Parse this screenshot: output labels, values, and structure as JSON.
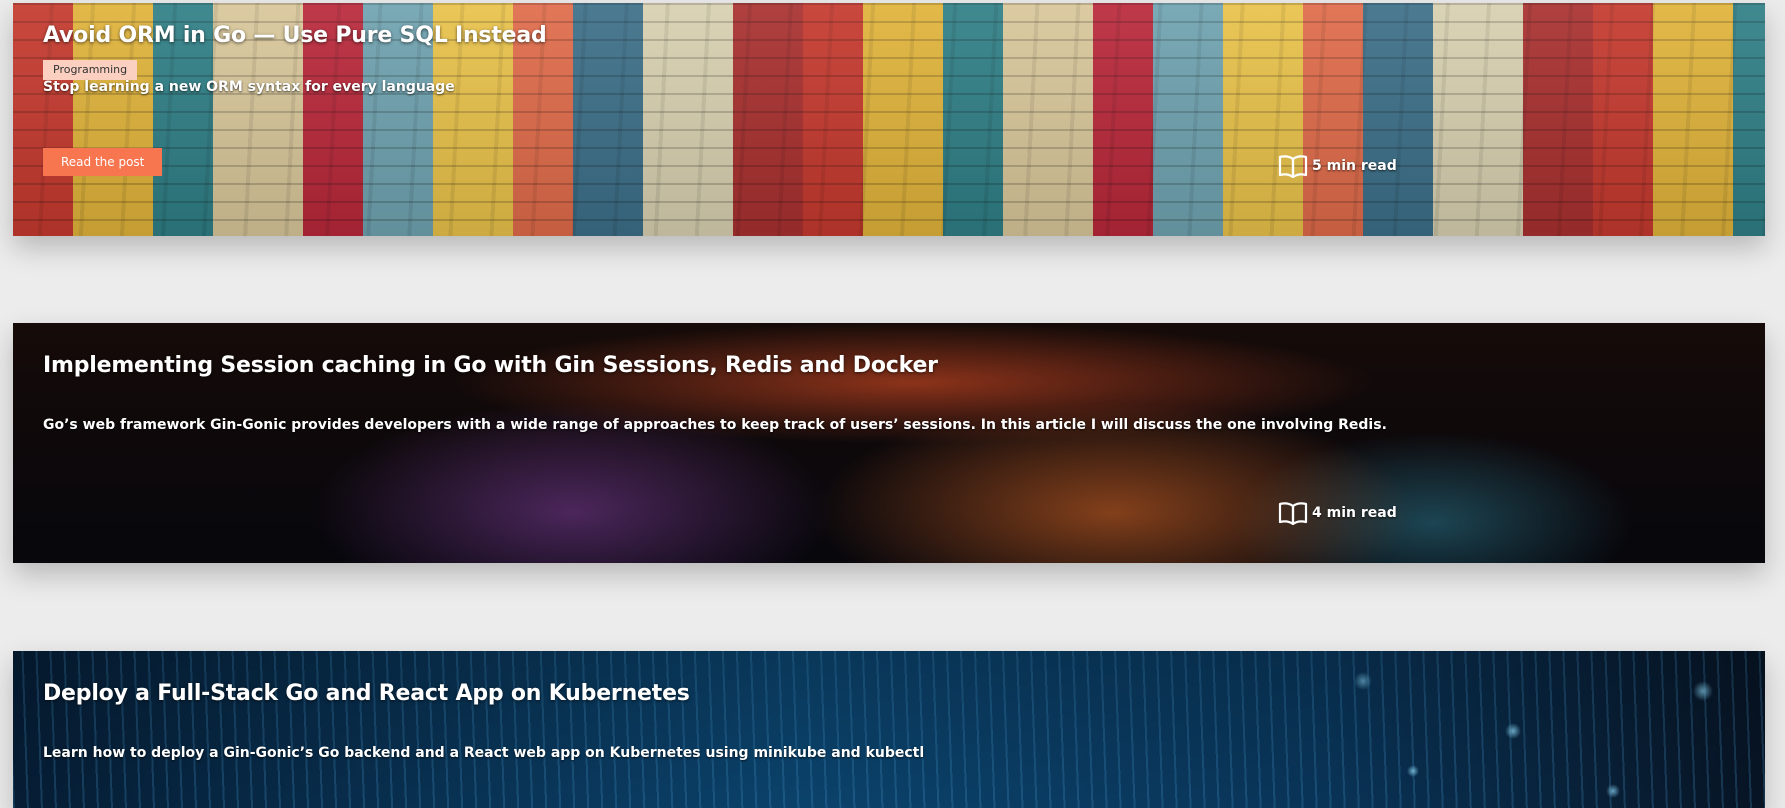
{
  "posts": [
    {
      "title": "Avoid ORM in Go — Use Pure SQL Instead",
      "tag": "Programming",
      "description": "Stop learning a new ORM syntax for every language",
      "button_label": "Read the post",
      "read_time": "5 min read",
      "read_time_icon": "open-book-icon"
    },
    {
      "title": "Implementing Session caching in Go with Gin Sessions, Redis and Docker",
      "description": "Go’s web framework Gin-Gonic provides developers with a wide range of approaches to keep track of users’ sessions. In this article I will discuss the one involving Redis.",
      "read_time": "4 min read",
      "read_time_icon": "open-book-icon"
    },
    {
      "title": "Deploy a Full-Stack Go and React App on Kubernetes",
      "description": "Learn how to deploy a Gin-Gonic’s Go backend and a React web app on Kubernetes using minikube and kubectl"
    }
  ],
  "colors": {
    "page_background": "#ececec",
    "tag_background": "#fbd0c1",
    "button_background": "#f7754f",
    "text_on_card": "#ffffff"
  }
}
